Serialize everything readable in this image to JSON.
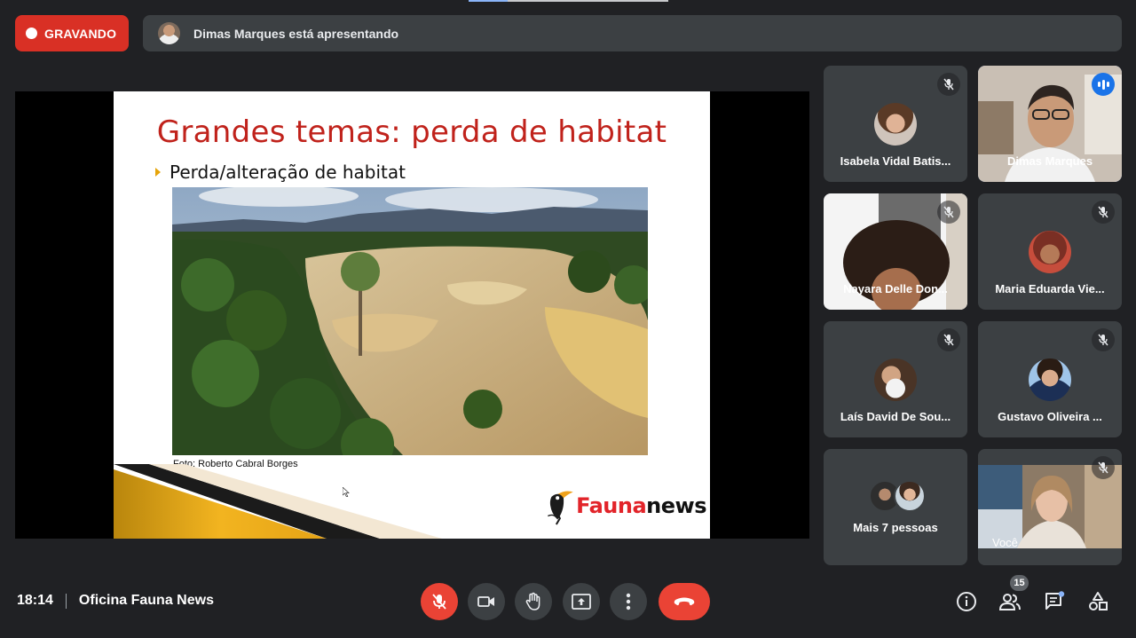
{
  "recording": {
    "label": "GRAVANDO"
  },
  "presenting": {
    "text": "Dimas Marques está apresentando"
  },
  "slide": {
    "title": "Grandes temas: perda de habitat",
    "bullet": "Perda/alteração de habitat",
    "photo_credit": "Foto: Roberto Cabral Borges",
    "logo_part1": "Fauna",
    "logo_part2": "news"
  },
  "participants": [
    {
      "name": "Isabela Vidal Batis...",
      "muted": true
    },
    {
      "name": "Dimas Marques",
      "speaking": true
    },
    {
      "name": "Nayara Delle Don...",
      "muted": true
    },
    {
      "name": "Maria Eduarda Vie...",
      "muted": true
    },
    {
      "name": "Laís David De Sou...",
      "muted": true
    },
    {
      "name": "Gustavo Oliveira ...",
      "muted": true
    },
    {
      "name": "Mais 7 pessoas"
    },
    {
      "name": "Você",
      "muted": true
    }
  ],
  "meeting": {
    "time": "18:14",
    "name": "Oficina Fauna News"
  },
  "people_count": "15",
  "colors": {
    "record_red": "#d93025",
    "hangup_red": "#ea4335",
    "accent_blue": "#8ab4f8",
    "tile_bg": "#3c4043"
  },
  "icons": [
    "mic-off-icon",
    "camera-icon",
    "raise-hand-icon",
    "present-screen-icon",
    "more-options-icon",
    "hang-up-icon",
    "info-icon",
    "people-icon",
    "chat-icon",
    "activities-icon"
  ]
}
